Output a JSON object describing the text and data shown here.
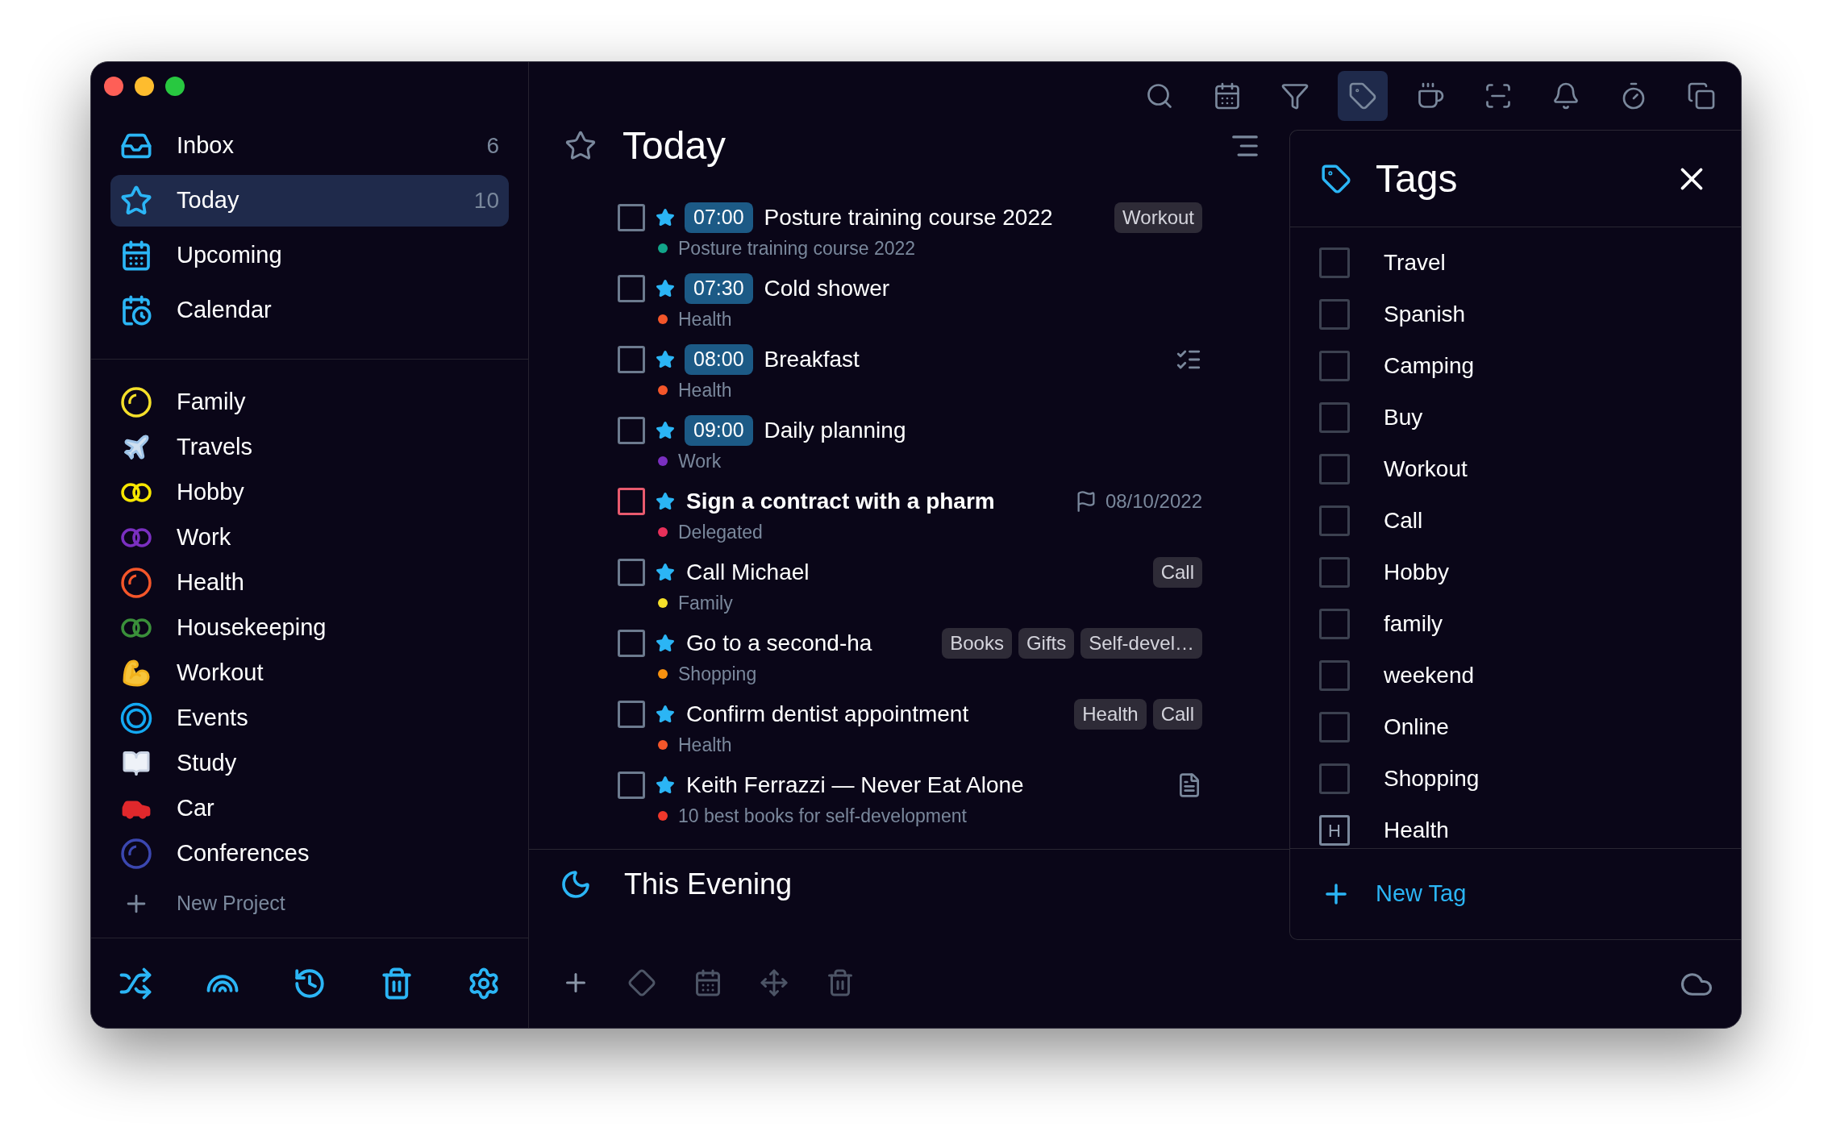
{
  "sidebar": {
    "views": [
      {
        "kind": "inbox",
        "label": "Inbox",
        "count": "6",
        "selected": false
      },
      {
        "kind": "star",
        "label": "Today",
        "count": "10",
        "selected": true
      },
      {
        "kind": "upcoming",
        "label": "Upcoming",
        "selected": false
      },
      {
        "kind": "calendar",
        "label": "Calendar",
        "selected": false
      }
    ],
    "projects": [
      {
        "kind": "ring",
        "label": "Family",
        "color": "#f5e02a"
      },
      {
        "kind": "plane",
        "label": "Travels"
      },
      {
        "kind": "double-ring",
        "label": "Hobby",
        "color": "#f7e600"
      },
      {
        "kind": "double-ring",
        "label": "Work",
        "color": "#7a2fc0"
      },
      {
        "kind": "ring",
        "label": "Health",
        "color": "#f4562a"
      },
      {
        "kind": "double-ring",
        "label": "Housekeeping",
        "color": "#3a8f3a"
      },
      {
        "kind": "arm",
        "label": "Workout"
      },
      {
        "kind": "target",
        "label": "Events",
        "color": "#14a9f2"
      },
      {
        "kind": "book",
        "label": "Study"
      },
      {
        "kind": "car",
        "label": "Car"
      },
      {
        "kind": "ring",
        "label": "Conferences",
        "color": "#3b47b0"
      }
    ],
    "new_project": "New Project"
  },
  "toolbar": [
    {
      "kind": "search",
      "selected": false
    },
    {
      "kind": "calendar",
      "selected": false
    },
    {
      "kind": "filter",
      "selected": false
    },
    {
      "kind": "tag",
      "selected": true
    },
    {
      "kind": "cup",
      "selected": false
    },
    {
      "kind": "focus",
      "selected": false
    },
    {
      "kind": "bell",
      "selected": false
    },
    {
      "kind": "timer",
      "selected": false
    },
    {
      "kind": "copy",
      "selected": false
    }
  ],
  "main": {
    "title": "Today",
    "tasks": [
      {
        "kind": "plain",
        "time": "07:00",
        "title": "Posture training course 2022",
        "bold": false,
        "checked": false,
        "color": "#6c7a8e",
        "starred": true,
        "project": {
          "name": "Posture training course 2022",
          "color": "#12a58a"
        },
        "tags": [
          "Workout"
        ]
      },
      {
        "kind": "plain",
        "time": "07:30",
        "title": "Cold shower",
        "bold": false,
        "checked": false,
        "color": "#6c7a8e",
        "starred": true,
        "project": {
          "name": "Health",
          "color": "#f4562a"
        }
      },
      {
        "kind": "checklist",
        "time": "08:00",
        "title": "Breakfast",
        "bold": false,
        "checked": false,
        "color": "#6c7a8e",
        "starred": true,
        "project": {
          "name": "Health",
          "color": "#f4562a"
        }
      },
      {
        "kind": "plain",
        "time": "09:00",
        "title": "Daily planning",
        "bold": false,
        "checked": false,
        "color": "#6c7a8e",
        "starred": true,
        "project": {
          "name": "Work",
          "color": "#7a2fc0"
        }
      },
      {
        "kind": "plain",
        "title": "Sign a contract with a pharm",
        "bold": true,
        "checked": false,
        "color": "#e85a6e",
        "starred": true,
        "project": {
          "name": "Delegated",
          "color": "#e8305a"
        },
        "date": "08/10/2022"
      },
      {
        "kind": "plain",
        "title": "Call Michael",
        "bold": false,
        "checked": false,
        "color": "#6c7a8e",
        "starred": true,
        "project": {
          "name": "Family",
          "color": "#f5e02a"
        },
        "tags": [
          "Call"
        ]
      },
      {
        "kind": "plain",
        "title": "Go to a second-ha",
        "bold": false,
        "checked": false,
        "color": "#6c7a8e",
        "starred": true,
        "project": {
          "name": "Shopping",
          "color": "#f7910f"
        },
        "tags": [
          "Books",
          "Gifts",
          "Self-devel…"
        ]
      },
      {
        "kind": "plain",
        "title": "Confirm dentist appointment",
        "bold": false,
        "checked": false,
        "color": "#6c7a8e",
        "starred": true,
        "project": {
          "name": "Health",
          "color": "#f4562a"
        },
        "tags": [
          "Health",
          "Call"
        ]
      },
      {
        "kind": "note",
        "title": "Keith Ferrazzi — Never Eat Alone",
        "bold": false,
        "checked": false,
        "color": "#6c7a8e",
        "starred": true,
        "project": {
          "name": "10 best books for self-development",
          "color": "#f0382b"
        }
      }
    ],
    "evening": "This Evening"
  },
  "tags_panel": {
    "title": "Tags",
    "items": [
      {
        "label": "Travel",
        "checked": false
      },
      {
        "label": "Spanish",
        "checked": false
      },
      {
        "label": "Camping",
        "checked": false
      },
      {
        "label": "Buy",
        "checked": false
      },
      {
        "label": "Workout",
        "checked": false
      },
      {
        "label": "Call",
        "checked": false
      },
      {
        "label": "Hobby",
        "checked": false
      },
      {
        "label": "family",
        "checked": false
      },
      {
        "label": "weekend",
        "checked": false
      },
      {
        "label": "Online",
        "checked": false
      },
      {
        "label": "Shopping",
        "checked": false
      },
      {
        "label": "Health",
        "shortcut": "H"
      }
    ],
    "new_tag": "New Tag"
  }
}
